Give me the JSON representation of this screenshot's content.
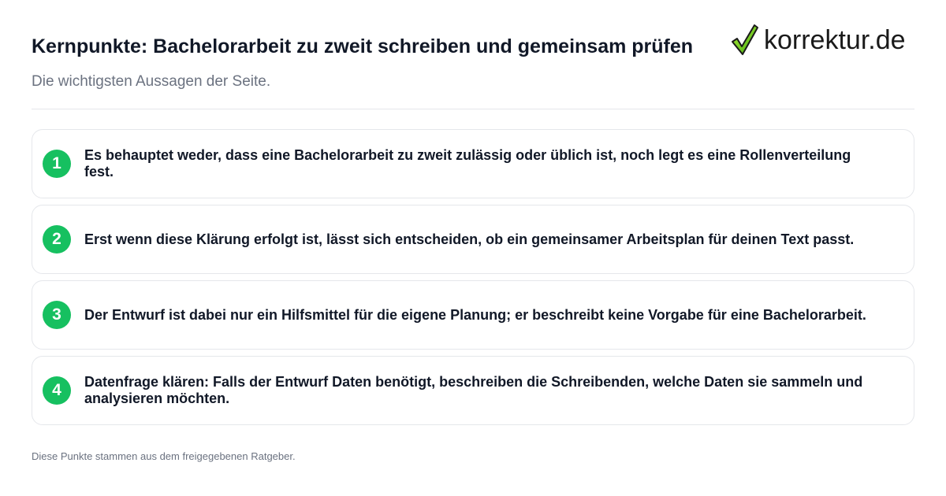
{
  "header": {
    "title": "Kernpunkte: Bachelorarbeit zu zweit schreiben und gemeinsam prüfen",
    "subtitle": "Die wichtigsten Aussagen der Seite."
  },
  "logo": {
    "text": "korrektur.de",
    "icon": "checkmark-icon",
    "accent_color": "#6fd11a"
  },
  "points": [
    {
      "number": "1",
      "text": "Es behauptet weder, dass eine Bachelorarbeit zu zweit zulässig oder üblich ist, noch legt es eine Rollenverteilung fest."
    },
    {
      "number": "2",
      "text": "Erst wenn diese Klärung erfolgt ist, lässt sich entscheiden, ob ein gemeinsamer Arbeitsplan für deinen Text passt."
    },
    {
      "number": "3",
      "text": "Der Entwurf ist dabei nur ein Hilfsmittel für die eigene Planung; er beschreibt keine Vorgabe für eine Bachelorarbeit."
    },
    {
      "number": "4",
      "text": "Datenfrage klären: Falls der Entwurf Daten benötigt, beschreiben die Schreibenden, welche Daten sie sammeln und analysieren möchten."
    }
  ],
  "footer": {
    "note": "Diese Punkte stammen aus dem freigegebenen Ratgeber."
  },
  "colors": {
    "badge": "#16c060",
    "title": "#111827",
    "muted": "#6b7280",
    "border": "#e5e7eb"
  }
}
